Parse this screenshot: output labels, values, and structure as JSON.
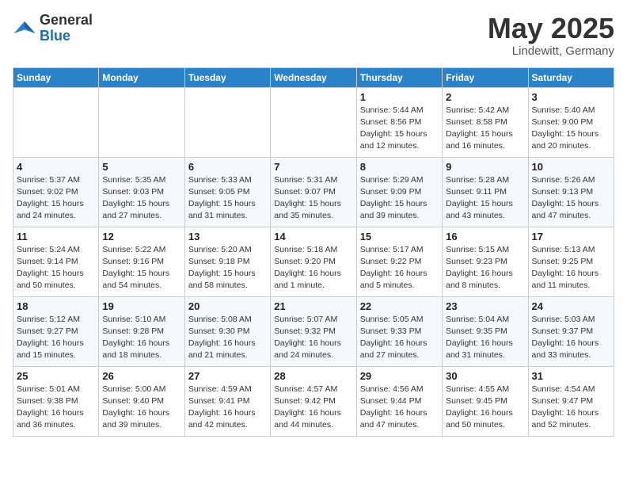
{
  "header": {
    "logo_general": "General",
    "logo_blue": "Blue",
    "month_title": "May 2025",
    "location": "Lindewitt, Germany"
  },
  "weekdays": [
    "Sunday",
    "Monday",
    "Tuesday",
    "Wednesday",
    "Thursday",
    "Friday",
    "Saturday"
  ],
  "weeks": [
    [
      {
        "day": "",
        "info": ""
      },
      {
        "day": "",
        "info": ""
      },
      {
        "day": "",
        "info": ""
      },
      {
        "day": "",
        "info": ""
      },
      {
        "day": "1",
        "info": "Sunrise: 5:44 AM\nSunset: 8:56 PM\nDaylight: 15 hours\nand 12 minutes."
      },
      {
        "day": "2",
        "info": "Sunrise: 5:42 AM\nSunset: 8:58 PM\nDaylight: 15 hours\nand 16 minutes."
      },
      {
        "day": "3",
        "info": "Sunrise: 5:40 AM\nSunset: 9:00 PM\nDaylight: 15 hours\nand 20 minutes."
      }
    ],
    [
      {
        "day": "4",
        "info": "Sunrise: 5:37 AM\nSunset: 9:02 PM\nDaylight: 15 hours\nand 24 minutes."
      },
      {
        "day": "5",
        "info": "Sunrise: 5:35 AM\nSunset: 9:03 PM\nDaylight: 15 hours\nand 27 minutes."
      },
      {
        "day": "6",
        "info": "Sunrise: 5:33 AM\nSunset: 9:05 PM\nDaylight: 15 hours\nand 31 minutes."
      },
      {
        "day": "7",
        "info": "Sunrise: 5:31 AM\nSunset: 9:07 PM\nDaylight: 15 hours\nand 35 minutes."
      },
      {
        "day": "8",
        "info": "Sunrise: 5:29 AM\nSunset: 9:09 PM\nDaylight: 15 hours\nand 39 minutes."
      },
      {
        "day": "9",
        "info": "Sunrise: 5:28 AM\nSunset: 9:11 PM\nDaylight: 15 hours\nand 43 minutes."
      },
      {
        "day": "10",
        "info": "Sunrise: 5:26 AM\nSunset: 9:13 PM\nDaylight: 15 hours\nand 47 minutes."
      }
    ],
    [
      {
        "day": "11",
        "info": "Sunrise: 5:24 AM\nSunset: 9:14 PM\nDaylight: 15 hours\nand 50 minutes."
      },
      {
        "day": "12",
        "info": "Sunrise: 5:22 AM\nSunset: 9:16 PM\nDaylight: 15 hours\nand 54 minutes."
      },
      {
        "day": "13",
        "info": "Sunrise: 5:20 AM\nSunset: 9:18 PM\nDaylight: 15 hours\nand 58 minutes."
      },
      {
        "day": "14",
        "info": "Sunrise: 5:18 AM\nSunset: 9:20 PM\nDaylight: 16 hours\nand 1 minute."
      },
      {
        "day": "15",
        "info": "Sunrise: 5:17 AM\nSunset: 9:22 PM\nDaylight: 16 hours\nand 5 minutes."
      },
      {
        "day": "16",
        "info": "Sunrise: 5:15 AM\nSunset: 9:23 PM\nDaylight: 16 hours\nand 8 minutes."
      },
      {
        "day": "17",
        "info": "Sunrise: 5:13 AM\nSunset: 9:25 PM\nDaylight: 16 hours\nand 11 minutes."
      }
    ],
    [
      {
        "day": "18",
        "info": "Sunrise: 5:12 AM\nSunset: 9:27 PM\nDaylight: 16 hours\nand 15 minutes."
      },
      {
        "day": "19",
        "info": "Sunrise: 5:10 AM\nSunset: 9:28 PM\nDaylight: 16 hours\nand 18 minutes."
      },
      {
        "day": "20",
        "info": "Sunrise: 5:08 AM\nSunset: 9:30 PM\nDaylight: 16 hours\nand 21 minutes."
      },
      {
        "day": "21",
        "info": "Sunrise: 5:07 AM\nSunset: 9:32 PM\nDaylight: 16 hours\nand 24 minutes."
      },
      {
        "day": "22",
        "info": "Sunrise: 5:05 AM\nSunset: 9:33 PM\nDaylight: 16 hours\nand 27 minutes."
      },
      {
        "day": "23",
        "info": "Sunrise: 5:04 AM\nSunset: 9:35 PM\nDaylight: 16 hours\nand 31 minutes."
      },
      {
        "day": "24",
        "info": "Sunrise: 5:03 AM\nSunset: 9:37 PM\nDaylight: 16 hours\nand 33 minutes."
      }
    ],
    [
      {
        "day": "25",
        "info": "Sunrise: 5:01 AM\nSunset: 9:38 PM\nDaylight: 16 hours\nand 36 minutes."
      },
      {
        "day": "26",
        "info": "Sunrise: 5:00 AM\nSunset: 9:40 PM\nDaylight: 16 hours\nand 39 minutes."
      },
      {
        "day": "27",
        "info": "Sunrise: 4:59 AM\nSunset: 9:41 PM\nDaylight: 16 hours\nand 42 minutes."
      },
      {
        "day": "28",
        "info": "Sunrise: 4:57 AM\nSunset: 9:42 PM\nDaylight: 16 hours\nand 44 minutes."
      },
      {
        "day": "29",
        "info": "Sunrise: 4:56 AM\nSunset: 9:44 PM\nDaylight: 16 hours\nand 47 minutes."
      },
      {
        "day": "30",
        "info": "Sunrise: 4:55 AM\nSunset: 9:45 PM\nDaylight: 16 hours\nand 50 minutes."
      },
      {
        "day": "31",
        "info": "Sunrise: 4:54 AM\nSunset: 9:47 PM\nDaylight: 16 hours\nand 52 minutes."
      }
    ]
  ]
}
